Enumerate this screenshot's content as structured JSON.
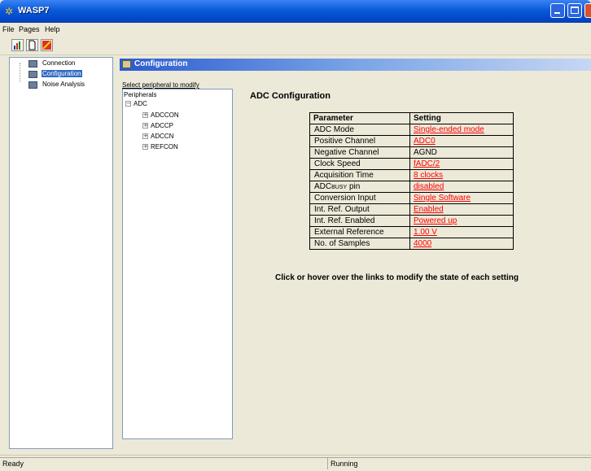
{
  "window": {
    "title": "WASP7"
  },
  "menu": [
    "File",
    "Pages",
    "Help"
  ],
  "toolbar": {
    "icons": [
      "chart-icon",
      "new-document-icon",
      "stop-icon"
    ]
  },
  "nav": {
    "items": [
      {
        "label": "Connection",
        "selected": false
      },
      {
        "label": "Configuration",
        "selected": true
      },
      {
        "label": "Noise Analysis",
        "selected": false
      }
    ]
  },
  "config": {
    "header": "Configuration",
    "select_label": "Select peripheral to modify",
    "tree": {
      "root": "Peripherals",
      "group": "ADC",
      "children": [
        "ADCCON",
        "ADCCP",
        "ADCCN",
        "REFCON"
      ]
    },
    "title": "ADC Configuration",
    "table": {
      "headers": [
        "Parameter",
        "Setting"
      ],
      "rows": [
        {
          "param": "ADC Mode",
          "setting": "Single-ended mode",
          "link": true
        },
        {
          "param": "Positive Channel",
          "setting": "ADC0",
          "link": true
        },
        {
          "param": "Negative Channel",
          "setting": "AGND",
          "link": false
        },
        {
          "param": "Clock Speed",
          "setting": "fADC/2",
          "link": true
        },
        {
          "param": "Acquisition Time",
          "setting": "8 clocks",
          "link": true
        },
        {
          "param": "ADC",
          "param_sub": "BUSY",
          "param_suffix": " pin",
          "setting": "disabled",
          "link": true
        },
        {
          "param": "Conversion Input",
          "setting": "Single Software",
          "link": true
        },
        {
          "param": "Int. Ref. Output",
          "setting": "Enabled",
          "link": true
        },
        {
          "param": "Int. Ref. Enabled",
          "setting": "Powered up",
          "link": true
        },
        {
          "param": "External Reference",
          "setting": "1.00 V",
          "link": true
        },
        {
          "param": "No. of Samples",
          "setting": "4000",
          "link": true
        }
      ]
    },
    "hint": "Click or hover over the links to modify the state of each setting"
  },
  "status": {
    "left": "Ready",
    "right": "Running"
  },
  "colors": {
    "titlebar": "#0a59d8",
    "link": "#ff0000",
    "selection": "#316ac5"
  }
}
